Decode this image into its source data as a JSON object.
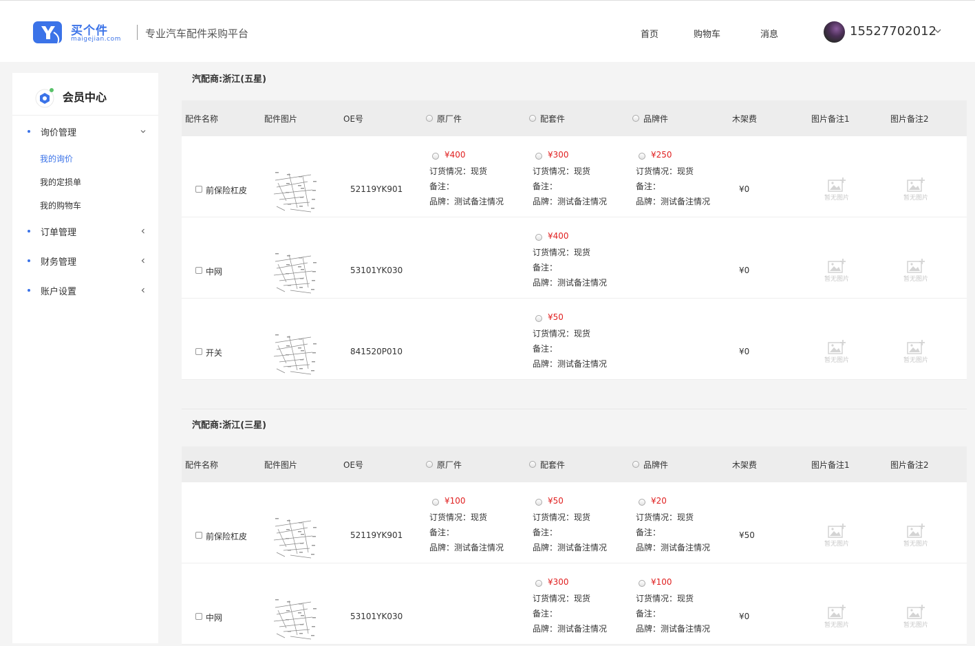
{
  "header": {
    "logo_cn": "买个件",
    "logo_en": "maigejian.com",
    "slogan": "专业汽车配件采购平台",
    "nav": [
      "首页",
      "购物车",
      "消息"
    ],
    "phone": "15527702012"
  },
  "sidebar": {
    "title": "会员中心",
    "menu": [
      {
        "label": "询价管理",
        "expanded": true,
        "children": [
          "我的询价",
          "我的定损单",
          "我的购物车"
        ],
        "active_child": 0
      },
      {
        "label": "订单管理"
      },
      {
        "label": "财务管理"
      },
      {
        "label": "账户设置"
      }
    ]
  },
  "columns": [
    "配件名称",
    "配件图片",
    "OE号",
    "原厂件",
    "配套件",
    "品牌件",
    "木架费",
    "图片备注1",
    "图片备注2"
  ],
  "labels": {
    "order_status_prefix": "订货情况：",
    "remark_prefix": "备注：",
    "brand_prefix": "品牌：",
    "no_image": "暂无图片"
  },
  "suppliers": [
    {
      "name": "汽配商:浙江(五星)",
      "rows": [
        {
          "name": "前保险杠皮",
          "oe": "52119YK901",
          "fee": "¥0",
          "prices": [
            {
              "price": "¥400",
              "status": "现货",
              "remark": "",
              "brand": "测试备注情况"
            },
            {
              "price": "¥300",
              "status": "现货",
              "remark": "",
              "brand": "测试备注情况"
            },
            {
              "price": "¥250",
              "status": "现货",
              "remark": "",
              "brand": "测试备注情况"
            }
          ]
        },
        {
          "name": "中网",
          "oe": "53101YK030",
          "fee": "¥0",
          "prices": [
            null,
            {
              "price": "¥400",
              "status": "现货",
              "remark": "",
              "brand": "测试备注情况"
            },
            null
          ]
        },
        {
          "name": "开关",
          "oe": "841520P010",
          "fee": "¥0",
          "prices": [
            null,
            {
              "price": "¥50",
              "status": "现货",
              "remark": "",
              "brand": "测试备注情况"
            },
            null
          ]
        }
      ]
    },
    {
      "name": "汽配商:浙江(三星)",
      "rows": [
        {
          "name": "前保险杠皮",
          "oe": "52119YK901",
          "fee": "¥50",
          "prices": [
            {
              "price": "¥100",
              "status": "现货",
              "remark": "",
              "brand": "测试备注情况"
            },
            {
              "price": "¥50",
              "status": "现货",
              "remark": "",
              "brand": "测试备注情况"
            },
            {
              "price": "¥20",
              "status": "现货",
              "remark": "",
              "brand": "测试备注情况"
            }
          ]
        },
        {
          "name": "中网",
          "oe": "53101YK030",
          "fee": "¥0",
          "prices": [
            null,
            {
              "price": "¥300",
              "status": "现货",
              "remark": "",
              "brand": "测试备注情况"
            },
            {
              "price": "¥100",
              "status": "现货",
              "remark": "",
              "brand": "测试备注情况"
            }
          ]
        }
      ]
    }
  ]
}
